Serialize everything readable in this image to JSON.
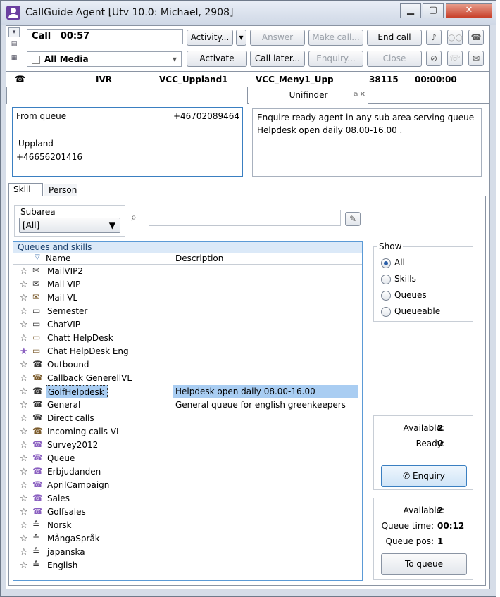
{
  "window": {
    "title": "CallGuide Agent [Utv 10.0: Michael, 2908]",
    "min": "▁",
    "max": "▢",
    "close": "✕"
  },
  "toolbar": {
    "call_state": "Call",
    "call_timer": "00:57",
    "activity": "Activity...",
    "activity_arrow": "▾",
    "answer": "Answer",
    "make_call": "Make call...",
    "end_call": "End call",
    "media": "All Media",
    "activate": "Activate",
    "call_later": "Call later...",
    "enquiry": "Enquiry...",
    "close": "Close"
  },
  "status": {
    "channel": "IVR",
    "queue": "VCC_Uppland1",
    "menu": "VCC_Meny1_Upp",
    "number": "38115",
    "time": "00:00:00"
  },
  "tabs": {
    "unifinder": "Unifinder",
    "float": "⧉",
    "close": "✕"
  },
  "contact": {
    "from": "From queue",
    "phone": "+46702089464",
    "area": "Uppland",
    "caller": "+46656201416"
  },
  "queue_info": {
    "line1": "Enquire ready agent in any sub area serving queue",
    "line2": "Helpdesk open daily 08.00-16.00 ."
  },
  "subtabs": {
    "skill": "Skill",
    "person": "Person"
  },
  "subarea": {
    "label": "Subarea",
    "value": "[All]"
  },
  "search": {
    "placeholder": ""
  },
  "list": {
    "title": "Queues and skills",
    "col_name": "Name",
    "col_desc": "Description",
    "sort": "▽",
    "rows": [
      {
        "name": "MailVIP2",
        "desc": "",
        "icon": "mail",
        "fav": false
      },
      {
        "name": "Mail VIP",
        "desc": "",
        "icon": "mail",
        "fav": false
      },
      {
        "name": "Mail VL",
        "desc": "",
        "icon": "mail-group",
        "fav": false
      },
      {
        "name": "Semester",
        "desc": "",
        "icon": "chat",
        "fav": false
      },
      {
        "name": "ChatVIP",
        "desc": "",
        "icon": "chat",
        "fav": false
      },
      {
        "name": "Chatt HelpDesk",
        "desc": "",
        "icon": "chat-group",
        "fav": false
      },
      {
        "name": "Chat  HelpDesk Eng",
        "desc": "",
        "icon": "chat-group",
        "fav": true
      },
      {
        "name": "Outbound",
        "desc": "",
        "icon": "phone-out",
        "fav": false
      },
      {
        "name": "Callback GenerellVL",
        "desc": "",
        "icon": "phone-group",
        "fav": false
      },
      {
        "name": "GolfHelpdesk",
        "desc": "Helpdesk open daily 08.00-16.00",
        "icon": "phone",
        "fav": false,
        "selected": true
      },
      {
        "name": "General",
        "desc": "General queue for english greenkeepers",
        "icon": "phone",
        "fav": false
      },
      {
        "name": "Direct calls",
        "desc": "",
        "icon": "phone",
        "fav": false
      },
      {
        "name": "Incoming calls VL",
        "desc": "",
        "icon": "phone-group",
        "fav": false
      },
      {
        "name": "Survey2012",
        "desc": "",
        "icon": "phone-purple",
        "fav": false
      },
      {
        "name": "Queue",
        "desc": "",
        "icon": "phone-purple",
        "fav": false
      },
      {
        "name": "Erbjudanden",
        "desc": "",
        "icon": "phone-purple-out",
        "fav": false
      },
      {
        "name": "AprilCampaign",
        "desc": "",
        "icon": "phone-purple",
        "fav": false
      },
      {
        "name": "Sales",
        "desc": "",
        "icon": "phone-purple-group",
        "fav": false
      },
      {
        "name": "Golfsales",
        "desc": "",
        "icon": "phone-purple-group",
        "fav": false
      },
      {
        "name": "Norsk",
        "desc": "",
        "icon": "skill",
        "fav": false
      },
      {
        "name": "MångaSpråk",
        "desc": "",
        "icon": "skill",
        "fav": false
      },
      {
        "name": "japanska",
        "desc": "",
        "icon": "skill",
        "fav": false
      },
      {
        "name": "English",
        "desc": "",
        "icon": "skill",
        "fav": false
      }
    ]
  },
  "show": {
    "label": "Show",
    "options": [
      "All",
      "Skills",
      "Queues",
      "Queueable"
    ],
    "selected": "All"
  },
  "stats1": {
    "available_label": "Available:",
    "available": "2",
    "ready_label": "Ready:",
    "ready": "0",
    "button": "Enquiry"
  },
  "stats2": {
    "available_label": "Available:",
    "available": "2",
    "qtime_label": "Queue time:",
    "qtime": "00:12",
    "qpos_label": "Queue pos:",
    "qpos": "1",
    "button": "To queue"
  },
  "colors": {
    "accent": "#3a7fc1",
    "selection": "#a9cdf2",
    "purple": "#8a5fc0"
  }
}
